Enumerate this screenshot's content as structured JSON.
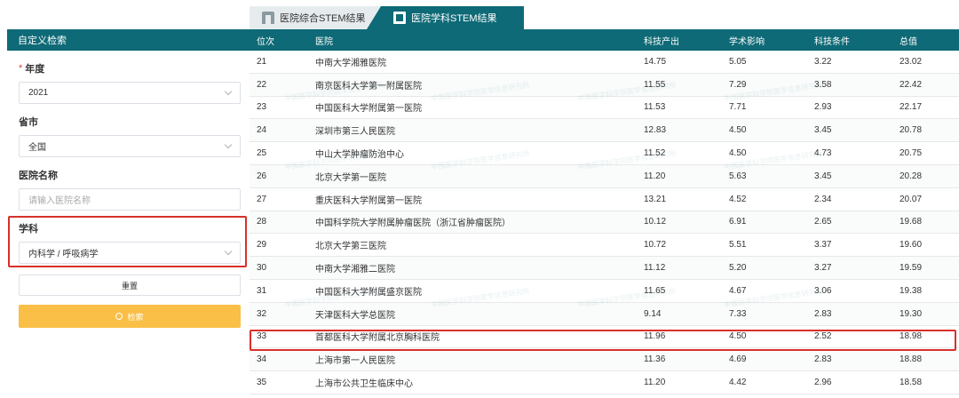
{
  "tabs": [
    {
      "label": "医院综合STEM结果",
      "active": false,
      "icon": "hospital-icon"
    },
    {
      "label": "医院学科STEM结果",
      "active": true,
      "icon": "book-icon"
    }
  ],
  "sidebar": {
    "title": "自定义检索",
    "year_label": "年度",
    "year_value": "2021",
    "province_label": "省市",
    "province_value": "全国",
    "hospital_label": "医院名称",
    "hospital_placeholder": "请输入医院名称",
    "subject_label": "学科",
    "subject_value": "内科学 / 呼吸病学",
    "reset_label": "重置",
    "search_label": "检索"
  },
  "table": {
    "headers": [
      "位次",
      "医院",
      "科技产出",
      "学术影响",
      "科技条件",
      "总值"
    ],
    "rows": [
      [
        "21",
        "中南大学湘雅医院",
        "14.75",
        "5.05",
        "3.22",
        "23.02"
      ],
      [
        "22",
        "南京医科大学第一附属医院",
        "11.55",
        "7.29",
        "3.58",
        "22.42"
      ],
      [
        "23",
        "中国医科大学附属第一医院",
        "11.53",
        "7.71",
        "2.93",
        "22.17"
      ],
      [
        "24",
        "深圳市第三人民医院",
        "12.83",
        "4.50",
        "3.45",
        "20.78"
      ],
      [
        "25",
        "中山大学肿瘤防治中心",
        "11.52",
        "4.50",
        "4.73",
        "20.75"
      ],
      [
        "26",
        "北京大学第一医院",
        "11.20",
        "5.63",
        "3.45",
        "20.28"
      ],
      [
        "27",
        "重庆医科大学附属第一医院",
        "13.21",
        "4.52",
        "2.34",
        "20.07"
      ],
      [
        "28",
        "中国科学院大学附属肿瘤医院（浙江省肿瘤医院）",
        "10.12",
        "6.91",
        "2.65",
        "19.68"
      ],
      [
        "29",
        "北京大学第三医院",
        "10.72",
        "5.51",
        "3.37",
        "19.60"
      ],
      [
        "30",
        "中南大学湘雅二医院",
        "11.12",
        "5.20",
        "3.27",
        "19.59"
      ],
      [
        "31",
        "中国医科大学附属盛京医院",
        "11.65",
        "4.67",
        "3.06",
        "19.38"
      ],
      [
        "32",
        "天津医科大学总医院",
        "9.14",
        "7.33",
        "2.83",
        "19.30"
      ],
      [
        "33",
        "首都医科大学附属北京胸科医院",
        "11.96",
        "4.50",
        "2.52",
        "18.98"
      ],
      [
        "34",
        "上海市第一人民医院",
        "11.36",
        "4.69",
        "2.83",
        "18.88"
      ],
      [
        "35",
        "上海市公共卫生临床中心",
        "11.20",
        "4.42",
        "2.96",
        "18.58"
      ]
    ]
  },
  "watermark": "中国医学科学院医学信息研究所",
  "colors": {
    "header": "#0e6a76",
    "accent": "#f9bf47",
    "highlight": "#d8302a"
  }
}
